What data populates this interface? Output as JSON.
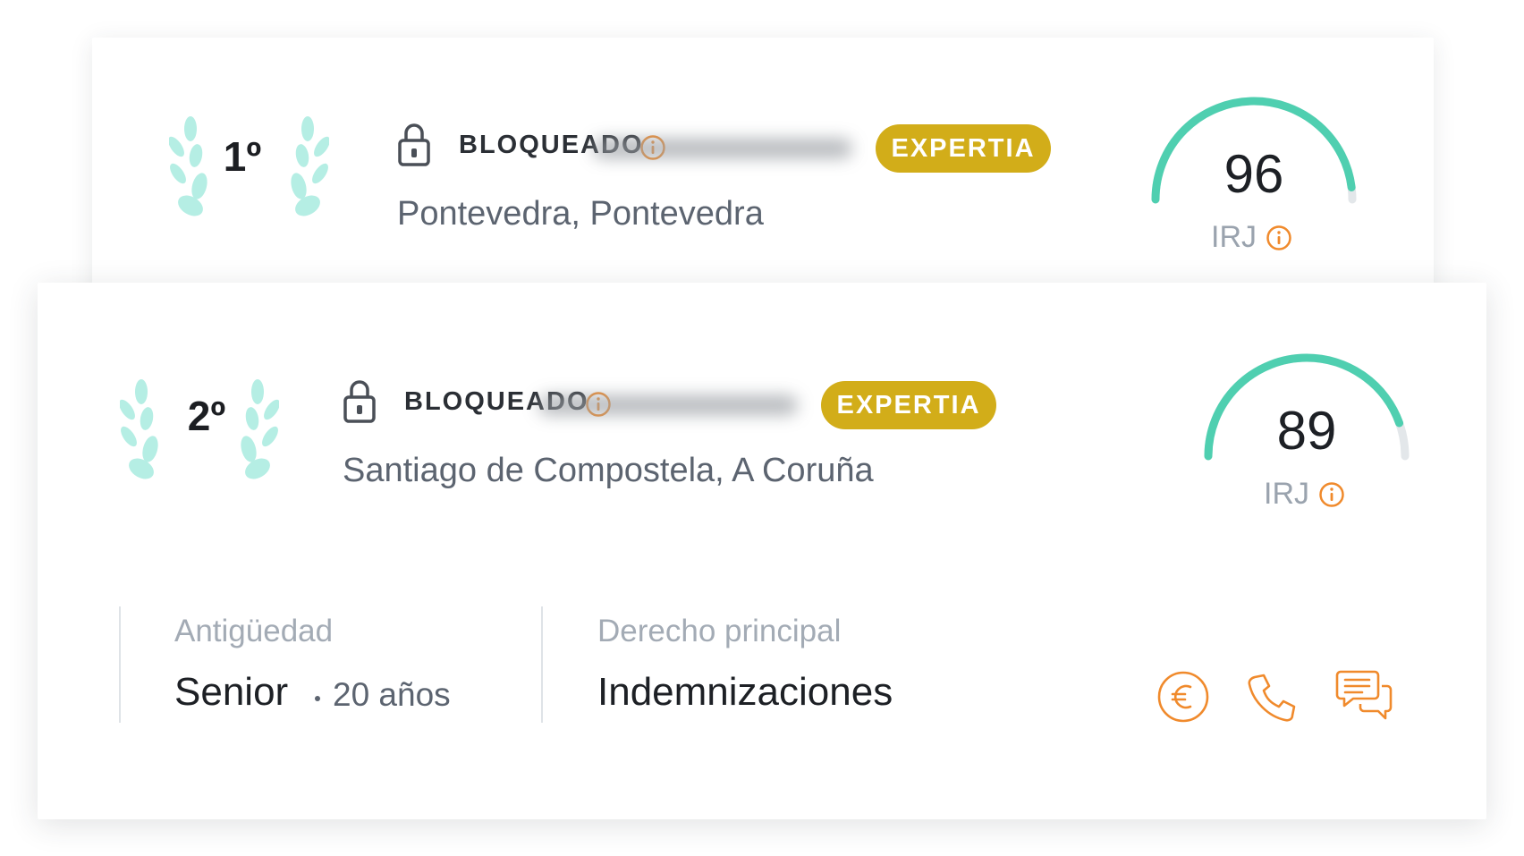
{
  "colors": {
    "accent_orange": "#f08a2c",
    "badge_gold": "#d2ad19",
    "gauge_teal": "#4fcfb0",
    "gauge_track": "#e3e7ea",
    "laurel_mint": "#b5eee4"
  },
  "results": [
    {
      "rank": "1º",
      "status": "BLOQUEADO",
      "badge": "EXPERTIA",
      "location": "Pontevedra, Pontevedra",
      "score": "96",
      "score_label": "IRJ",
      "gauge_fill": 0.96
    },
    {
      "rank": "2º",
      "status": "BLOQUEADO",
      "badge": "EXPERTIA",
      "location": "Santiago de Compostela, A Coruña",
      "score": "89",
      "score_label": "IRJ",
      "gauge_fill": 0.89,
      "details": {
        "seniority_label": "Antigüedad",
        "seniority_value": "Senior",
        "seniority_years": "20 años",
        "practice_label": "Derecho principal",
        "practice_value": "Indemnizaciones"
      },
      "actions": [
        "euro-icon",
        "phone-icon",
        "chat-icon"
      ]
    }
  ]
}
